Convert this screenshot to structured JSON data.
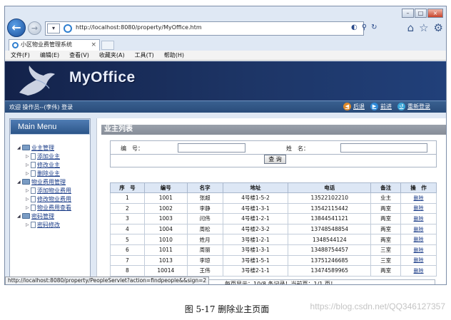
{
  "browser": {
    "address_url": "http://localhost:8080/property/MyOffice.htm",
    "tab_title": "小区物业费管理系统",
    "tab_close": "×",
    "window_controls": [
      "–",
      "□",
      "×"
    ]
  },
  "menu": [
    "文件(F)",
    "编辑(E)",
    "查看(V)",
    "收藏夹(A)",
    "工具(T)",
    "帮助(H)"
  ],
  "banner": {
    "logo_text": "MyOffice"
  },
  "user_bar": {
    "welcome": "欢迎 操作员--(李伟) 登录",
    "back_label": "后退",
    "forward_label": "前进",
    "relogin_label": "重新登录"
  },
  "sidebar": {
    "title": "Main Menu",
    "groups": [
      {
        "label": "业主管理",
        "items": [
          "添加业主",
          "修改业主",
          "删除业主"
        ]
      },
      {
        "label": "物业费用管理",
        "items": [
          "添加物业费用",
          "修改物业费用",
          "物业费用查看"
        ]
      },
      {
        "label": "密码管理",
        "items": [
          "密码修改"
        ]
      }
    ]
  },
  "content": {
    "section_title": "业主列表",
    "form": {
      "id_label": "编　号：",
      "name_label": "姓　名：",
      "query_button": "查 询"
    },
    "table": {
      "headers": [
        "序　号",
        "编号",
        "名字",
        "地址",
        "电话",
        "备注",
        "操　作"
      ],
      "rows": [
        [
          "1",
          "1001",
          "张超",
          "4号楼1-5-2",
          "13522102210",
          "业主",
          "删除"
        ],
        [
          "2",
          "1002",
          "李静",
          "4号楼1-3-1",
          "13542115442",
          "两室",
          "删除"
        ],
        [
          "3",
          "1003",
          "闫伟",
          "4号楼1-2-1",
          "13844541121",
          "两室",
          "删除"
        ],
        [
          "4",
          "1004",
          "周松",
          "4号楼2-3-2",
          "13748548854",
          "两室",
          "删除"
        ],
        [
          "5",
          "1010",
          "姓月",
          "3号楼1-2-1",
          "1348544124",
          "两室",
          "删除"
        ],
        [
          "6",
          "1011",
          "周丽",
          "3号楼1-3-1",
          "13488754457",
          "三室",
          "删除"
        ],
        [
          "7",
          "1013",
          "李琼",
          "3号楼1-5-1",
          "13751246685",
          "三室",
          "删除"
        ],
        [
          "8",
          "10014",
          "王伟",
          "3号楼2-1-1",
          "13474589965",
          "两室",
          "删除"
        ]
      ]
    },
    "pager": "每页显示：10/8 条记录！当前页：1/1 页！"
  },
  "status_url": "http://localhost:8080/property/PeopleServlet?action=findpeople&&sign=2",
  "caption": "图 5-17 删除业主页面",
  "watermark": "https://blog.csdn.net/QQ346127357"
}
